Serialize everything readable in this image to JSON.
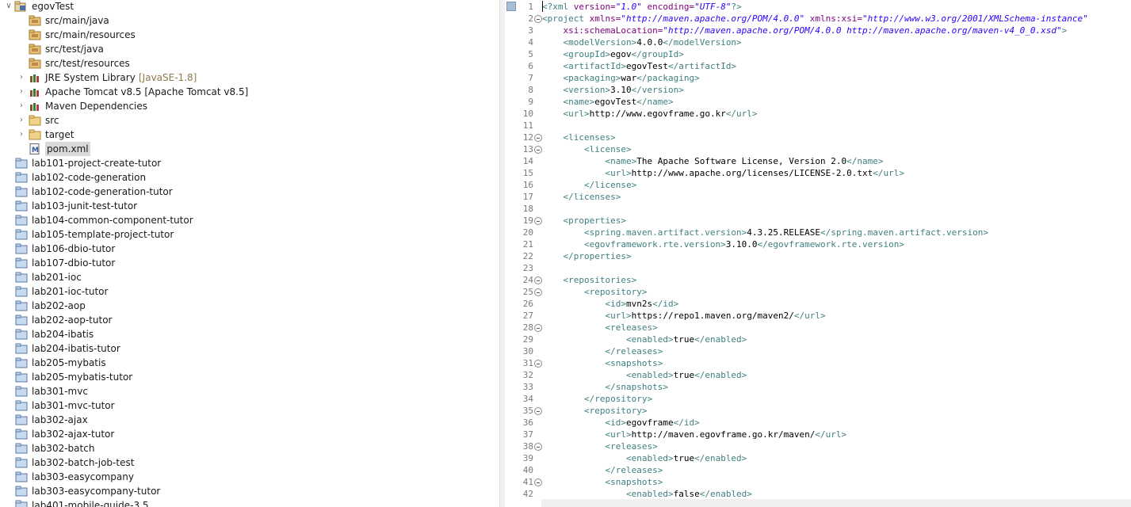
{
  "explorer": {
    "items": [
      {
        "label": "egovTest",
        "icon": "project-icon",
        "arrow": "expanded"
      },
      {
        "label": "src/main/java",
        "icon": "source-folder-icon",
        "arrow": ""
      },
      {
        "label": "src/main/resources",
        "icon": "source-folder-icon",
        "arrow": ""
      },
      {
        "label": "src/test/java",
        "icon": "source-folder-icon",
        "arrow": ""
      },
      {
        "label": "src/test/resources",
        "icon": "source-folder-icon",
        "arrow": ""
      },
      {
        "label": "JRE System Library",
        "decoration": "[JavaSE-1.8]",
        "icon": "library-icon",
        "arrow": "collapsed"
      },
      {
        "label": "Apache Tomcat v8.5 [Apache Tomcat v8.5]",
        "icon": "library-icon",
        "arrow": "collapsed"
      },
      {
        "label": "Maven Dependencies",
        "icon": "library-icon",
        "arrow": "collapsed"
      },
      {
        "label": "src",
        "icon": "folder-icon",
        "arrow": "collapsed"
      },
      {
        "label": "target",
        "icon": "folder-icon",
        "arrow": "collapsed"
      },
      {
        "label": "pom.xml",
        "icon": "xml-file-icon",
        "arrow": "",
        "selected": true
      },
      {
        "label": "lab101-project-create-tutor",
        "icon": "closed-project-icon",
        "arrow": ""
      },
      {
        "label": "lab102-code-generation",
        "icon": "closed-project-icon",
        "arrow": ""
      },
      {
        "label": "lab102-code-generation-tutor",
        "icon": "closed-project-icon",
        "arrow": ""
      },
      {
        "label": "lab103-junit-test-tutor",
        "icon": "closed-project-icon",
        "arrow": ""
      },
      {
        "label": "lab104-common-component-tutor",
        "icon": "closed-project-icon",
        "arrow": ""
      },
      {
        "label": "lab105-template-project-tutor",
        "icon": "closed-project-icon",
        "arrow": ""
      },
      {
        "label": "lab106-dbio-tutor",
        "icon": "closed-project-icon",
        "arrow": ""
      },
      {
        "label": "lab107-dbio-tutor",
        "icon": "closed-project-icon",
        "arrow": ""
      },
      {
        "label": "lab201-ioc",
        "icon": "closed-project-icon",
        "arrow": ""
      },
      {
        "label": "lab201-ioc-tutor",
        "icon": "closed-project-icon",
        "arrow": ""
      },
      {
        "label": "lab202-aop",
        "icon": "closed-project-icon",
        "arrow": ""
      },
      {
        "label": "lab202-aop-tutor",
        "icon": "closed-project-icon",
        "arrow": ""
      },
      {
        "label": "lab204-ibatis",
        "icon": "closed-project-icon",
        "arrow": ""
      },
      {
        "label": "lab204-ibatis-tutor",
        "icon": "closed-project-icon",
        "arrow": ""
      },
      {
        "label": "lab205-mybatis",
        "icon": "closed-project-icon",
        "arrow": ""
      },
      {
        "label": "lab205-mybatis-tutor",
        "icon": "closed-project-icon",
        "arrow": ""
      },
      {
        "label": "lab301-mvc",
        "icon": "closed-project-icon",
        "arrow": ""
      },
      {
        "label": "lab301-mvc-tutor",
        "icon": "closed-project-icon",
        "arrow": ""
      },
      {
        "label": "lab302-ajax",
        "icon": "closed-project-icon",
        "arrow": ""
      },
      {
        "label": "lab302-ajax-tutor",
        "icon": "closed-project-icon",
        "arrow": ""
      },
      {
        "label": "lab302-batch",
        "icon": "closed-project-icon",
        "arrow": ""
      },
      {
        "label": "lab302-batch-job-test",
        "icon": "closed-project-icon",
        "arrow": ""
      },
      {
        "label": "lab303-easycompany",
        "icon": "closed-project-icon",
        "arrow": ""
      },
      {
        "label": "lab303-easycompany-tutor",
        "icon": "closed-project-icon",
        "arrow": ""
      },
      {
        "label": "lab401-mobile-guide-3.5",
        "icon": "closed-project-icon",
        "arrow": ""
      }
    ]
  },
  "editor": {
    "lines": [
      {
        "num": "1",
        "fold": false,
        "tokens": [
          [
            "pi",
            "<?xml "
          ],
          [
            "attr",
            "version="
          ],
          [
            "str",
            "\"1.0\""
          ],
          [
            "attr",
            " encoding="
          ],
          [
            "str",
            "\"UTF-8\""
          ],
          [
            "pi",
            "?>"
          ]
        ]
      },
      {
        "num": "2",
        "fold": true,
        "tokens": [
          [
            "tag",
            "<project "
          ],
          [
            "attr",
            "xmlns="
          ],
          [
            "str",
            "\"http://maven.apache.org/POM/4.0.0\""
          ],
          [
            "attr",
            " xmlns:xsi="
          ],
          [
            "str",
            "\"http://www.w3.org/2001/XMLSchema-instance\""
          ]
        ]
      },
      {
        "num": "3",
        "fold": false,
        "tokens": [
          [
            "attr",
            "    xsi:schemaLocation="
          ],
          [
            "str",
            "\"http://maven.apache.org/POM/4.0.0 http://maven.apache.org/maven-v4_0_0.xsd\""
          ],
          [
            "tag",
            ">"
          ]
        ]
      },
      {
        "num": "4",
        "fold": false,
        "tokens": [
          [
            "text",
            "    "
          ],
          [
            "tag",
            "<modelVersion>"
          ],
          [
            "text",
            "4.0.0"
          ],
          [
            "tag",
            "</modelVersion>"
          ]
        ]
      },
      {
        "num": "5",
        "fold": false,
        "tokens": [
          [
            "text",
            "    "
          ],
          [
            "tag",
            "<groupId>"
          ],
          [
            "text",
            "egov"
          ],
          [
            "tag",
            "</groupId>"
          ]
        ]
      },
      {
        "num": "6",
        "fold": false,
        "tokens": [
          [
            "text",
            "    "
          ],
          [
            "tag",
            "<artifactId>"
          ],
          [
            "text",
            "egovTest"
          ],
          [
            "tag",
            "</artifactId>"
          ]
        ]
      },
      {
        "num": "7",
        "fold": false,
        "tokens": [
          [
            "text",
            "    "
          ],
          [
            "tag",
            "<packaging>"
          ],
          [
            "text",
            "war"
          ],
          [
            "tag",
            "</packaging>"
          ]
        ]
      },
      {
        "num": "8",
        "fold": false,
        "tokens": [
          [
            "text",
            "    "
          ],
          [
            "tag",
            "<version>"
          ],
          [
            "text",
            "3.10"
          ],
          [
            "tag",
            "</version>"
          ]
        ]
      },
      {
        "num": "9",
        "fold": false,
        "tokens": [
          [
            "text",
            "    "
          ],
          [
            "tag",
            "<name>"
          ],
          [
            "text",
            "egovTest"
          ],
          [
            "tag",
            "</name>"
          ]
        ]
      },
      {
        "num": "10",
        "fold": false,
        "tokens": [
          [
            "text",
            "    "
          ],
          [
            "tag",
            "<url>"
          ],
          [
            "text",
            "http://www.egovframe.go.kr"
          ],
          [
            "tag",
            "</url>"
          ]
        ]
      },
      {
        "num": "11",
        "fold": false,
        "tokens": []
      },
      {
        "num": "12",
        "fold": true,
        "tokens": [
          [
            "text",
            "    "
          ],
          [
            "tag",
            "<licenses>"
          ]
        ]
      },
      {
        "num": "13",
        "fold": true,
        "tokens": [
          [
            "text",
            "        "
          ],
          [
            "tag",
            "<license>"
          ]
        ]
      },
      {
        "num": "14",
        "fold": false,
        "tokens": [
          [
            "text",
            "            "
          ],
          [
            "tag",
            "<name>"
          ],
          [
            "text",
            "The Apache Software License, Version 2.0"
          ],
          [
            "tag",
            "</name>"
          ]
        ]
      },
      {
        "num": "15",
        "fold": false,
        "tokens": [
          [
            "text",
            "            "
          ],
          [
            "tag",
            "<url>"
          ],
          [
            "text",
            "http://www.apache.org/licenses/LICENSE-2.0.txt"
          ],
          [
            "tag",
            "</url>"
          ]
        ]
      },
      {
        "num": "16",
        "fold": false,
        "tokens": [
          [
            "text",
            "        "
          ],
          [
            "tag",
            "</license>"
          ]
        ]
      },
      {
        "num": "17",
        "fold": false,
        "tokens": [
          [
            "text",
            "    "
          ],
          [
            "tag",
            "</licenses>"
          ]
        ]
      },
      {
        "num": "18",
        "fold": false,
        "tokens": []
      },
      {
        "num": "19",
        "fold": true,
        "tokens": [
          [
            "text",
            "    "
          ],
          [
            "tag",
            "<properties>"
          ]
        ]
      },
      {
        "num": "20",
        "fold": false,
        "tokens": [
          [
            "text",
            "        "
          ],
          [
            "tag",
            "<spring.maven.artifact.version>"
          ],
          [
            "text",
            "4.3.25.RELEASE"
          ],
          [
            "tag",
            "</spring.maven.artifact.version>"
          ]
        ]
      },
      {
        "num": "21",
        "fold": false,
        "tokens": [
          [
            "text",
            "        "
          ],
          [
            "tag",
            "<egovframework.rte.version>"
          ],
          [
            "text",
            "3.10.0"
          ],
          [
            "tag",
            "</egovframework.rte.version>"
          ]
        ]
      },
      {
        "num": "22",
        "fold": false,
        "tokens": [
          [
            "text",
            "    "
          ],
          [
            "tag",
            "</properties>"
          ]
        ]
      },
      {
        "num": "23",
        "fold": false,
        "tokens": []
      },
      {
        "num": "24",
        "fold": true,
        "tokens": [
          [
            "text",
            "    "
          ],
          [
            "tag",
            "<repositories>"
          ]
        ]
      },
      {
        "num": "25",
        "fold": true,
        "tokens": [
          [
            "text",
            "        "
          ],
          [
            "tag",
            "<repository>"
          ]
        ]
      },
      {
        "num": "26",
        "fold": false,
        "tokens": [
          [
            "text",
            "            "
          ],
          [
            "tag",
            "<id>"
          ],
          [
            "text",
            "mvn2s"
          ],
          [
            "tag",
            "</id>"
          ]
        ]
      },
      {
        "num": "27",
        "fold": false,
        "tokens": [
          [
            "text",
            "            "
          ],
          [
            "tag",
            "<url>"
          ],
          [
            "text",
            "https://repo1.maven.org/maven2/"
          ],
          [
            "tag",
            "</url>"
          ]
        ]
      },
      {
        "num": "28",
        "fold": true,
        "tokens": [
          [
            "text",
            "            "
          ],
          [
            "tag",
            "<releases>"
          ]
        ]
      },
      {
        "num": "29",
        "fold": false,
        "tokens": [
          [
            "text",
            "                "
          ],
          [
            "tag",
            "<enabled>"
          ],
          [
            "text",
            "true"
          ],
          [
            "tag",
            "</enabled>"
          ]
        ]
      },
      {
        "num": "30",
        "fold": false,
        "tokens": [
          [
            "text",
            "            "
          ],
          [
            "tag",
            "</releases>"
          ]
        ]
      },
      {
        "num": "31",
        "fold": true,
        "tokens": [
          [
            "text",
            "            "
          ],
          [
            "tag",
            "<snapshots>"
          ]
        ]
      },
      {
        "num": "32",
        "fold": false,
        "tokens": [
          [
            "text",
            "                "
          ],
          [
            "tag",
            "<enabled>"
          ],
          [
            "text",
            "true"
          ],
          [
            "tag",
            "</enabled>"
          ]
        ]
      },
      {
        "num": "33",
        "fold": false,
        "tokens": [
          [
            "text",
            "            "
          ],
          [
            "tag",
            "</snapshots>"
          ]
        ]
      },
      {
        "num": "34",
        "fold": false,
        "tokens": [
          [
            "text",
            "        "
          ],
          [
            "tag",
            "</repository>"
          ]
        ]
      },
      {
        "num": "35",
        "fold": true,
        "tokens": [
          [
            "text",
            "        "
          ],
          [
            "tag",
            "<repository>"
          ]
        ]
      },
      {
        "num": "36",
        "fold": false,
        "tokens": [
          [
            "text",
            "            "
          ],
          [
            "tag",
            "<id>"
          ],
          [
            "text",
            "egovframe"
          ],
          [
            "tag",
            "</id>"
          ]
        ]
      },
      {
        "num": "37",
        "fold": false,
        "tokens": [
          [
            "text",
            "            "
          ],
          [
            "tag",
            "<url>"
          ],
          [
            "text",
            "http://maven.egovframe.go.kr/maven/"
          ],
          [
            "tag",
            "</url>"
          ]
        ]
      },
      {
        "num": "38",
        "fold": true,
        "tokens": [
          [
            "text",
            "            "
          ],
          [
            "tag",
            "<releases>"
          ]
        ]
      },
      {
        "num": "39",
        "fold": false,
        "tokens": [
          [
            "text",
            "                "
          ],
          [
            "tag",
            "<enabled>"
          ],
          [
            "text",
            "true"
          ],
          [
            "tag",
            "</enabled>"
          ]
        ]
      },
      {
        "num": "40",
        "fold": false,
        "tokens": [
          [
            "text",
            "            "
          ],
          [
            "tag",
            "</releases>"
          ]
        ]
      },
      {
        "num": "41",
        "fold": true,
        "tokens": [
          [
            "text",
            "            "
          ],
          [
            "tag",
            "<snapshots>"
          ]
        ]
      },
      {
        "num": "42",
        "fold": false,
        "tokens": [
          [
            "text",
            "                "
          ],
          [
            "tag",
            "<enabled>"
          ],
          [
            "text",
            "false"
          ],
          [
            "tag",
            "</enabled>"
          ]
        ]
      }
    ]
  }
}
